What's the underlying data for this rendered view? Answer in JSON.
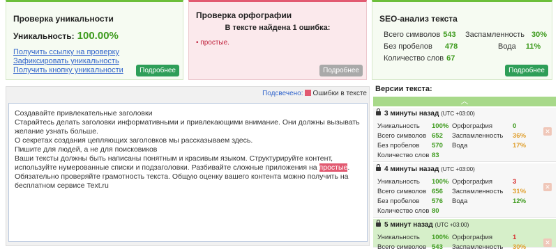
{
  "uniqueness": {
    "title": "Проверка уникальности",
    "label": "Уникальность:",
    "value": "100.00%",
    "links": [
      "Получить ссылку на проверку",
      "Зафиксировать уникальность",
      "Получить кнопку уникальности"
    ],
    "button": "Подробнее"
  },
  "spelling": {
    "title": "Проверка орфографии",
    "found": "В тексте найдена 1 ошибка:",
    "error": "простые.",
    "button": "Подробнее"
  },
  "seo": {
    "title": "SEO-анализ текста",
    "total_label": "Всего символов",
    "total": "543",
    "nospace_label": "Без пробелов",
    "nospace": "478",
    "words_label": "Количество слов",
    "words": "67",
    "spam_label": "Заспамленность",
    "spam": "30%",
    "water_label": "Вода",
    "water": "11%",
    "button": "Подробнее"
  },
  "editor": {
    "legend_label": "Подсвечено:",
    "legend_text": "Ошибки в тексте",
    "lines": [
      "Создавайте привлекательные заголовки",
      "Старайтесь делать заголовки информативными и привлекающими внимание. Они должны вызывать желание узнать больше.",
      "О секретах создания цепляющих заголовков мы рассказываем здесь.",
      "Пишите для людей, а не для поисковиков",
      "Ваши тексты должны быть написаны понятным и красивым языком. Структурируйте контент, используйте нумерованные списки и подзаголовки. Разбивайте сложные приложения на "
    ],
    "highlight": "простые",
    "tail": ". Обязательно проверяйте грамотность текста. Общую оценку вашего контента можно получить на бесплатном сервисе Text.ru"
  },
  "versions": {
    "title": "Версии текста:",
    "labels": {
      "uniq": "Уникальность",
      "total": "Всего символов",
      "nospace": "Без пробелов",
      "words": "Количество слов",
      "spelling": "Орфография",
      "spam": "Заспамленность",
      "water": "Вода"
    },
    "items": [
      {
        "time": "3 минуты назад",
        "tz": "(UTC +03:00)",
        "uniq": "100%",
        "total": "652",
        "nospace": "570",
        "words": "83",
        "spelling": "0",
        "spam": "36%",
        "water": "17%"
      },
      {
        "time": "4 минуты назад",
        "tz": "(UTC +03:00)",
        "uniq": "100%",
        "total": "656",
        "nospace": "576",
        "words": "80",
        "spelling": "3",
        "spam": "31%",
        "water": "12%"
      },
      {
        "time": "5 минут назад",
        "tz": "(UTC +03:00)",
        "uniq": "100%",
        "total": "543",
        "spelling": "1",
        "spam": "30%"
      }
    ]
  }
}
